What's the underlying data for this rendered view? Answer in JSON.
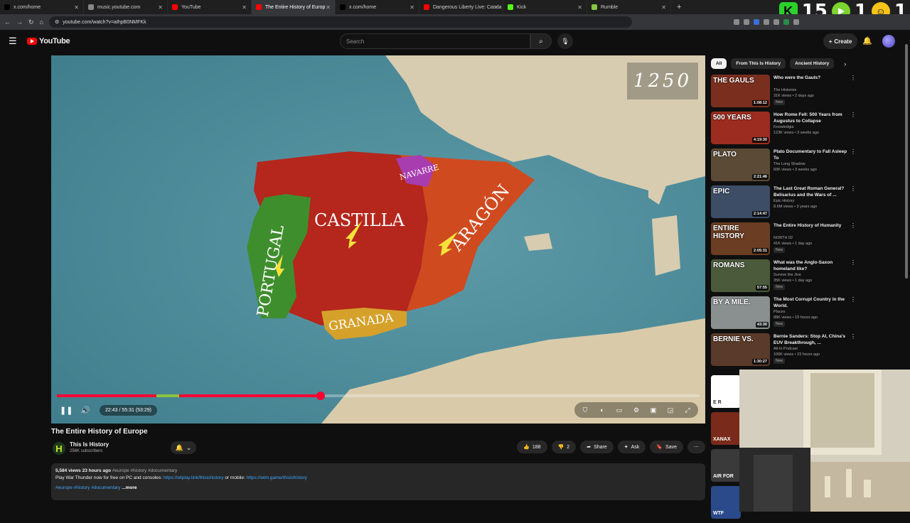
{
  "browser": {
    "tabs": [
      {
        "label": "x.com/home",
        "color": "#000000",
        "active": false
      },
      {
        "label": "music.youtube.com",
        "color": "#888888",
        "active": false
      },
      {
        "label": "YouTube",
        "color": "#ff0000",
        "active": false
      },
      {
        "label": "The Entire History of Europ",
        "color": "#ff0000",
        "active": true
      },
      {
        "label": "x.com/home",
        "color": "#000000",
        "active": false
      },
      {
        "label": "Dangerous Liberty Live: Canda",
        "color": "#ff0000",
        "active": false
      },
      {
        "label": "Kick",
        "color": "#53fc18",
        "active": false
      },
      {
        "label": "Rumble",
        "color": "#85c742",
        "active": false
      }
    ],
    "url": "youtube.com/watch?v=aIhpB0NMFKk",
    "overlay": {
      "k": "K",
      "num1": "15",
      "num2": "1",
      "num3": "1"
    }
  },
  "header": {
    "logo": "YouTube",
    "search_placeholder": "Search",
    "create_label": "Create"
  },
  "player": {
    "year": "1250",
    "regions": [
      "NAVARRE",
      "CASTILLA",
      "ARAGÓN",
      "PORTUGAL",
      "GRANADA"
    ],
    "time": "22:43 / 55:31 (53:29)",
    "progress": 0.41,
    "hover_start": 0.155,
    "hover_end": 0.19
  },
  "video": {
    "title": "The Entire History of Europe",
    "channel": "This Is History",
    "subscribers": "256K subscribers",
    "likes": "188",
    "dislikes": "2",
    "share": "Share",
    "ask": "Ask",
    "save": "Save",
    "desc_meta": "5,584 views  23 hours ago",
    "desc_tags": "#europe #history #documentary",
    "desc_line2_pre": "Play War Thunder now for free on PC and consoles: ",
    "desc_link1": "https://wtplay.link/thisishistory",
    "desc_or": " or mobile: ",
    "desc_link2": "https://wtm.game/thisishistory",
    "desc_line3": "#europe #history #documentary",
    "desc_more": "...more"
  },
  "sidebar": {
    "chips": [
      "All",
      "From This Is History",
      "Ancient History"
    ],
    "recs": [
      {
        "title": "Who were the Gauls?",
        "channel": "The Histories",
        "views": "31K views • 2 days ago",
        "badge": "New",
        "duration": "1:08:12",
        "thumb_label": "THE GAULS",
        "color": "#7a2f1e"
      },
      {
        "title": "How Rome Fell: 500 Years from Augustus to Collapse",
        "channel": "Knowledgia",
        "views": "123K views • 3 weeks ago",
        "badge": "",
        "duration": "4:19:30",
        "thumb_label": "500 YEARS",
        "color": "#9b2c1f"
      },
      {
        "title": "Plato Documentary to Fall Asleep To",
        "channel": "The Long Shadow",
        "views": "60K views • 3 weeks ago",
        "badge": "",
        "duration": "2:21:46",
        "thumb_label": "PLATO",
        "color": "#5b4a35"
      },
      {
        "title": "The Last Great Roman General? Belisarius and the Wars of ...",
        "channel": "Epic History",
        "views": "8.6M views • 3 years ago",
        "badge": "",
        "duration": "2:14:47",
        "thumb_label": "EPIC",
        "color": "#3d4d66"
      },
      {
        "title": "The Entire History of Humanity",
        "channel": "NORTH 02",
        "views": "41K views • 1 day ago",
        "badge": "New",
        "duration": "2:05:31",
        "thumb_label": "ENTIRE HISTORY",
        "color": "#6b3d22"
      },
      {
        "title": "What was the Anglo-Saxon homeland like?",
        "channel": "Survive the Jive",
        "views": "35K views • 1 day ago",
        "badge": "New",
        "duration": "57:55",
        "thumb_label": "ROMANS",
        "color": "#4a5a3a"
      },
      {
        "title": "The Most Corrupt Country in the World.",
        "channel": "Places",
        "views": "88K views • 19 hours ago",
        "badge": "New",
        "duration": "43:30",
        "thumb_label": "BY A MILE.",
        "color": "#8a8f8f"
      },
      {
        "title": "Bernie Sanders: Stop AI, China's EUV Breakthrough, ...",
        "channel": "All-In Podcast",
        "views": "106K views • 23 hours ago",
        "badge": "New",
        "duration": "1:30:27",
        "thumb_label": "BERNIE VS.",
        "color": "#5a3a2a"
      }
    ],
    "mini": [
      {
        "label": "E R",
        "color": "#ffffff"
      },
      {
        "label": "XANAX",
        "color": "#7a2a1a"
      },
      {
        "label": "AIR FOR",
        "color": "#3a3a3a"
      },
      {
        "label": "WTF",
        "color": "#2a4a8a"
      }
    ]
  }
}
